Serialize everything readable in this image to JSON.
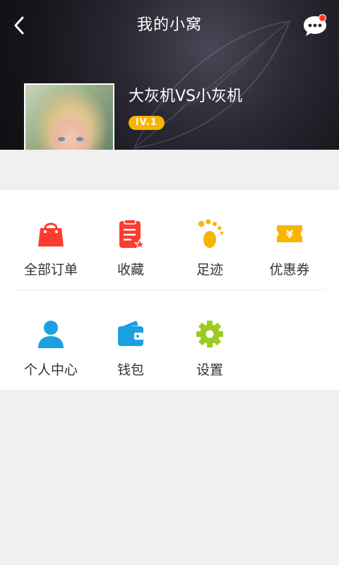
{
  "header": {
    "title": "我的小窝",
    "back_icon": "back-arrow-icon",
    "message_icon": "chat-bubble-icon",
    "has_unread_dot": true
  },
  "profile": {
    "username": "大灰机VS小灰机",
    "level": "lV.1",
    "avatar": "avatar-photo"
  },
  "menu": {
    "row1": [
      {
        "label": "全部订单",
        "icon": "shopping-bag-icon",
        "color": "#ff3b30"
      },
      {
        "label": "收藏",
        "icon": "favorite-list-icon",
        "color": "#ff3b30"
      },
      {
        "label": "足迹",
        "icon": "footprint-icon",
        "color": "#f7b500"
      },
      {
        "label": "优惠券",
        "icon": "coupon-icon",
        "color": "#f7b500"
      }
    ],
    "row2": [
      {
        "label": "个人中心",
        "icon": "person-icon",
        "color": "#1ba1e2"
      },
      {
        "label": "钱包",
        "icon": "wallet-icon",
        "color": "#1ba1e2"
      },
      {
        "label": "设置",
        "icon": "gear-icon",
        "color": "#9ccc20"
      }
    ]
  },
  "colors": {
    "header_bg": "#1a1a20",
    "badge": "#f7b500",
    "page_bg": "#f0f0f0"
  }
}
